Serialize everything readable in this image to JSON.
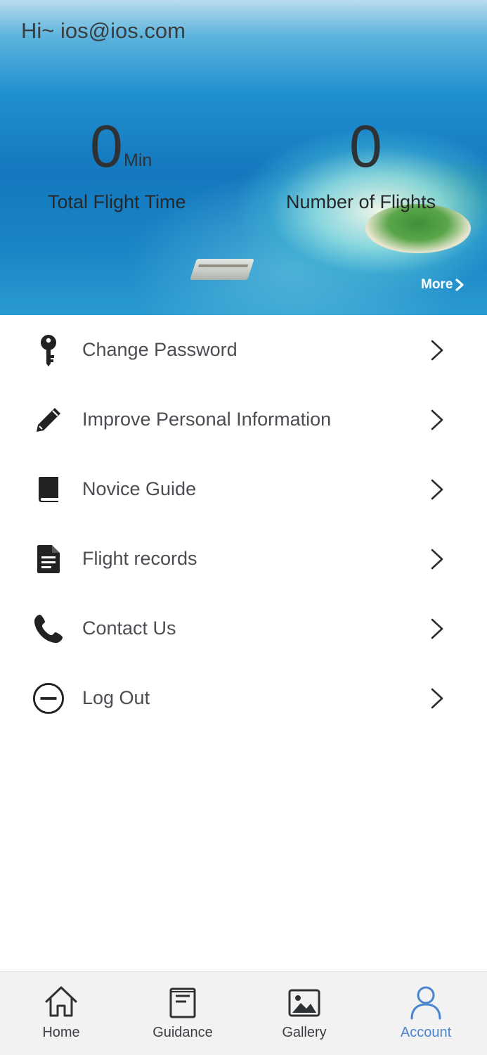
{
  "header": {
    "greeting": "Hi~ ios@ios.com"
  },
  "stats": {
    "flight_time_value": "0",
    "flight_time_unit": "Min",
    "flight_time_label": "Total Flight Time",
    "flights_value": "0",
    "flights_label": "Number of Flights",
    "more_label": "More"
  },
  "menu": {
    "items": [
      {
        "label": "Change Password",
        "icon": "key-icon"
      },
      {
        "label": "Improve Personal Information",
        "icon": "pencil-icon"
      },
      {
        "label": "Novice Guide",
        "icon": "book-icon"
      },
      {
        "label": "Flight records",
        "icon": "document-icon"
      },
      {
        "label": "Contact Us",
        "icon": "phone-icon"
      },
      {
        "label": "Log Out",
        "icon": "minus-circle-icon"
      }
    ]
  },
  "tabbar": {
    "tabs": [
      {
        "label": "Home",
        "icon": "home-icon"
      },
      {
        "label": "Guidance",
        "icon": "guidance-icon"
      },
      {
        "label": "Gallery",
        "icon": "gallery-icon"
      },
      {
        "label": "Account",
        "icon": "account-icon"
      }
    ],
    "active_color": "#4a86cf",
    "inactive_color": "#3b3f43"
  }
}
